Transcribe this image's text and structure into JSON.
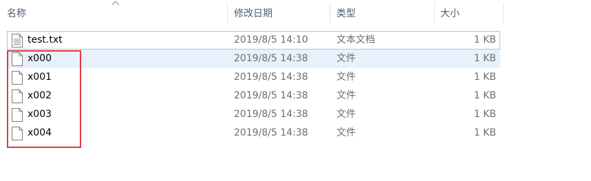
{
  "columns": {
    "name": "名称",
    "modified": "修改日期",
    "type": "类型",
    "size": "大小"
  },
  "sort": {
    "column": "name",
    "direction": "ascending",
    "icon": "sort-ascending-arrow-icon"
  },
  "files": [
    {
      "name": "test.txt",
      "modified": "2019/8/5 14:10",
      "type": "文本文档",
      "size": "1 KB",
      "icon": "text-file-icon",
      "state": "focused"
    },
    {
      "name": "x000",
      "modified": "2019/8/5 14:38",
      "type": "文件",
      "size": "1 KB",
      "icon": "blank-file-icon",
      "state": "selected"
    },
    {
      "name": "x001",
      "modified": "2019/8/5 14:38",
      "type": "文件",
      "size": "1 KB",
      "icon": "blank-file-icon",
      "state": "normal"
    },
    {
      "name": "x002",
      "modified": "2019/8/5 14:38",
      "type": "文件",
      "size": "1 KB",
      "icon": "blank-file-icon",
      "state": "normal"
    },
    {
      "name": "x003",
      "modified": "2019/8/5 14:38",
      "type": "文件",
      "size": "1 KB",
      "icon": "blank-file-icon",
      "state": "normal"
    },
    {
      "name": "x004",
      "modified": "2019/8/5 14:38",
      "type": "文件",
      "size": "1 KB",
      "icon": "blank-file-icon",
      "state": "normal"
    }
  ],
  "colors": {
    "header_text": "#4c607a",
    "selection": "#e8f1fb",
    "focus_outline": "#99c9ef",
    "annotation_box": "#e0393e"
  }
}
